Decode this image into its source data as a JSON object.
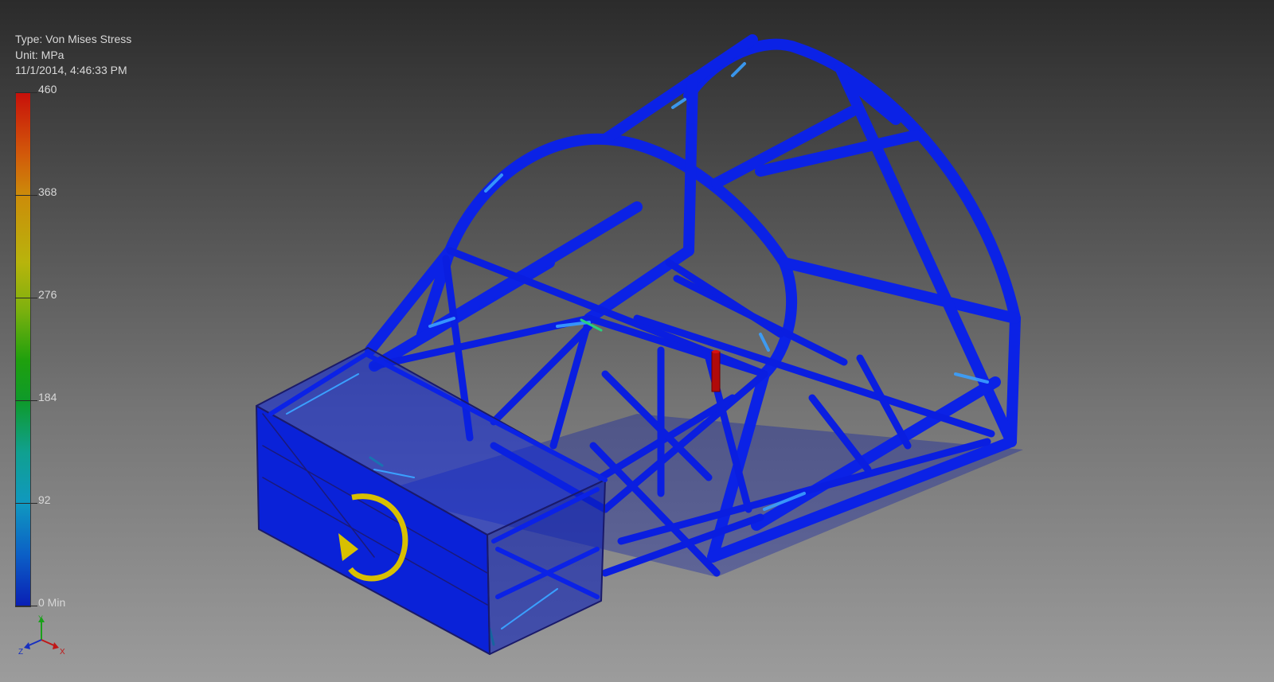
{
  "result_info": {
    "type": "Type: Von Mises Stress",
    "unit": "Unit: MPa",
    "timestamp": "11/1/2014, 4:46:33 PM"
  },
  "legend": {
    "labels": [
      "460",
      "368",
      "276",
      "184",
      "92",
      "0 Min"
    ],
    "max": 460,
    "min": 0,
    "colors": {
      "max": "#c8100a",
      "min": "#0a1fb5"
    }
  },
  "model": {
    "description_colors": {
      "frame": "#0b22e6",
      "highlight": "#3aa0ff",
      "load_marker": "#b00a0a",
      "moment_arrow": "#d8c000"
    }
  },
  "view_triad": {
    "x": "X",
    "y": "Y",
    "z": "Z"
  }
}
